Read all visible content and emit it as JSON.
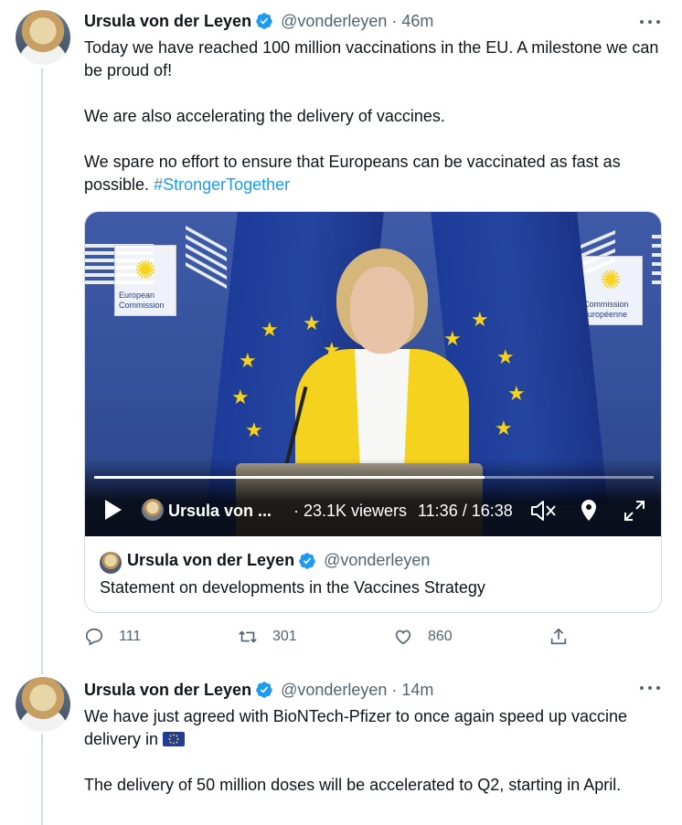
{
  "tweets": [
    {
      "author": {
        "name": "Ursula von der Leyen",
        "handle": "@vonderleyen",
        "verified": true
      },
      "time": "46m",
      "paragraphs": [
        "Today we have reached 100 million vaccinations in the EU. A milestone we can be proud of!",
        "We are also accelerating the delivery of vaccines.",
        "We spare no effort to ensure that Europeans can be vaccinated as fast as possible."
      ],
      "hashtag": "#StrongerTogether",
      "video": {
        "logo_left": [
          "European",
          "Commission"
        ],
        "logo_right": [
          "Commission",
          "européenne"
        ],
        "broadcaster": "Ursula von ...",
        "viewers": "· 23.1K viewers",
        "time": "11:36 / 16:38",
        "progress_fraction": 0.698
      },
      "quote": {
        "name": "Ursula von der Leyen",
        "handle": "@vonderleyen",
        "text": "Statement on developments in the Vaccines Strategy"
      },
      "actions": {
        "replies": "111",
        "retweets": "301",
        "likes": "860"
      }
    },
    {
      "author": {
        "name": "Ursula von der Leyen",
        "handle": "@vonderleyen",
        "verified": true
      },
      "time": "14m",
      "paragraphs": [
        "We have just agreed with BioNTech-Pfizer to once again speed up vaccine delivery in",
        "The delivery of 50 million doses will be accelerated to Q2, starting in April."
      ],
      "emoji": "eu-flag-emoji"
    }
  ],
  "colors": {
    "accent": "#1d9bf0",
    "secondary_text": "#536471",
    "border": "#cfd9de"
  }
}
